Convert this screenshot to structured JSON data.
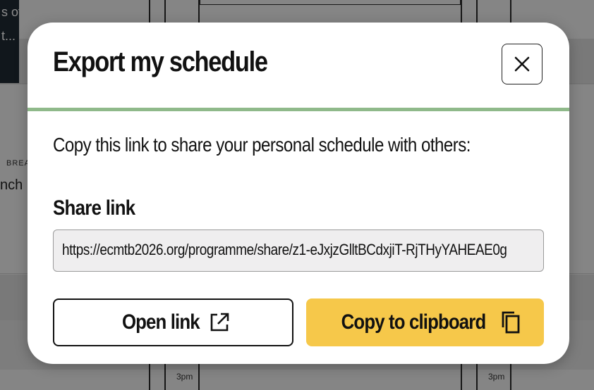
{
  "background": {
    "card_text_lines": [
      "s of",
      "t..."
    ],
    "tag": "BREAK",
    "session_title": "nch B",
    "time_label": "3pm"
  },
  "modal": {
    "title": "Export my schedule",
    "close_icon": "close-icon",
    "description": "Copy this link to share your personal schedule with others:",
    "share_link_label": "Share link",
    "share_link_value": "https://ecmtb2026.org/programme/share/z1-eJxjzGlltBCdxjiT-RjTHyYAHEAE0g",
    "open_link_label": "Open link",
    "open_link_icon": "external-link-icon",
    "copy_label": "Copy to clipboard",
    "copy_icon": "copy-icon"
  },
  "colors": {
    "accent_divider": "#8fb98a",
    "copy_button": "#f6c84a",
    "input_background": "#efeeef"
  }
}
